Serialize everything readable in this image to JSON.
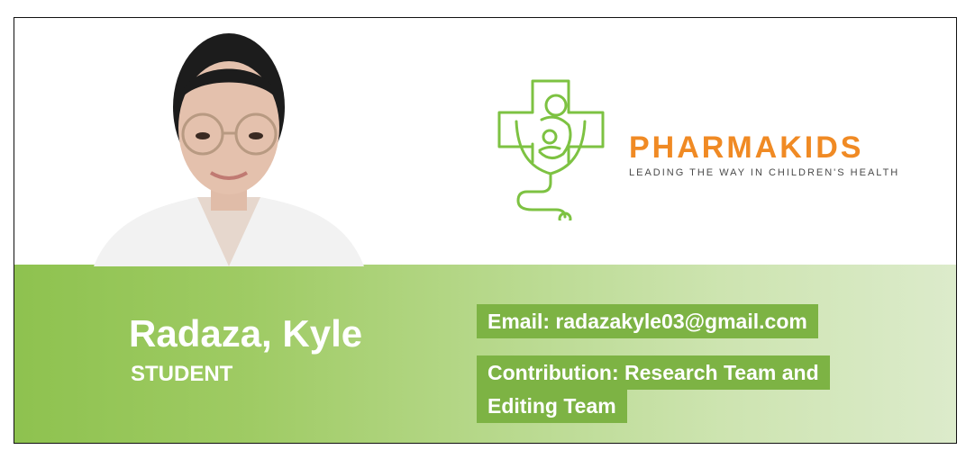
{
  "profile": {
    "name": "Radaza, Kyle",
    "role": "STUDENT",
    "email": "Email: radazakyle03@gmail.com",
    "contribution_line1": "Contribution: Research Team and",
    "contribution_line2": "Editing Team"
  },
  "brand": {
    "name": "PHARMAKIDS",
    "tagline": "LEADING THE WAY IN CHILDREN'S HEALTH"
  },
  "colors": {
    "brand_orange": "#f08a24",
    "brand_green": "#7dc242",
    "band_start": "#8ec24f",
    "band_end": "#dcebcb"
  },
  "icons": {
    "logo": "cross-mother-child-stethoscope-icon"
  }
}
